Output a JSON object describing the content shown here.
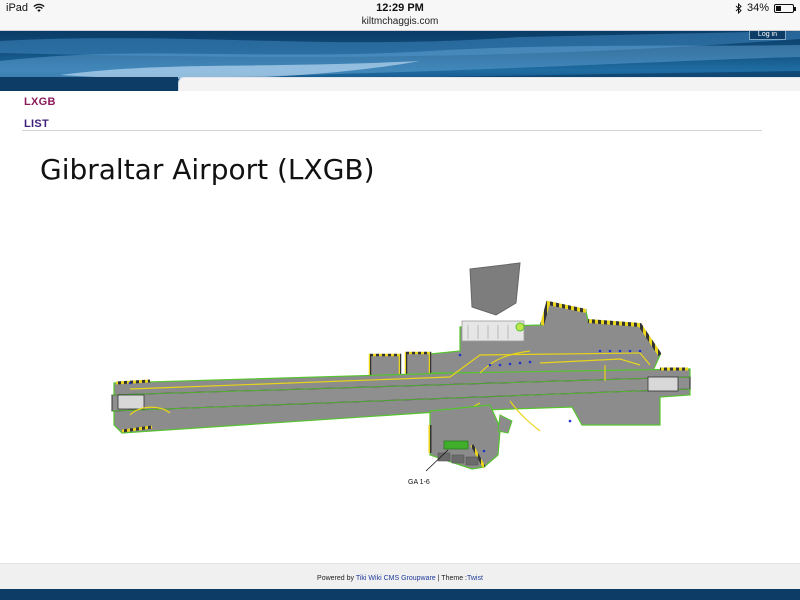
{
  "statusbar": {
    "device": "iPad",
    "time": "12:29 PM",
    "url": "kiltmchaggis.com",
    "battery": "34%",
    "battery_level": 0.34
  },
  "header": {
    "login_label": "Log in"
  },
  "nav": {
    "lxgb_label": "LXGB",
    "list_label": "LIST"
  },
  "page": {
    "title": "Gibraltar Airport (LXGB)"
  },
  "map": {
    "callout_label": "GA 1-6",
    "colors": {
      "pavement": "#8c8c8c",
      "outline": "#56c42e",
      "taxiline": "#e7d51a",
      "runway_edge": "#2f2f2f",
      "stand_light": "#2233cc",
      "ga_area": "#3fae2a"
    }
  },
  "footer": {
    "powered_by": "Powered by",
    "cms_link": "Tiki Wiki CMS Groupware",
    "separator": " | Theme :",
    "theme_link": "Twist"
  }
}
